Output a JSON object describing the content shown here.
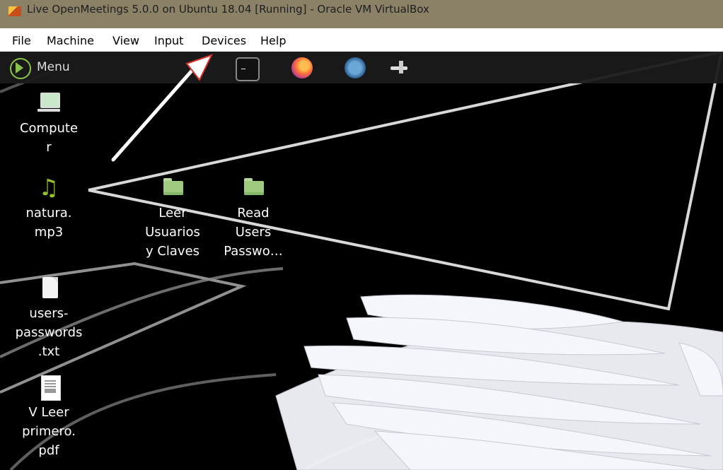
{
  "window": {
    "title": "Live OpenMeetings 5.0.0 on Ubuntu 18.04 [Running] - Oracle VM VirtualBox"
  },
  "menubar": {
    "items": [
      "File",
      "Machine",
      "View",
      "Input",
      "Devices",
      "Help"
    ]
  },
  "panel": {
    "menu_label": "Menu",
    "launchers": [
      "terminal-icon",
      "firefox-icon",
      "network-globe-icon",
      "usb-device-icon"
    ]
  },
  "desktop": {
    "icons": [
      {
        "name": "computer-icon",
        "label": "Compute\nr"
      },
      {
        "name": "music-file-icon",
        "label": "natura.\nmp3"
      },
      {
        "name": "folder-icon",
        "label": "Leer\nUsuarios\ny Claves"
      },
      {
        "name": "folder-icon",
        "label": "Read\nUsers\nPasswo…"
      },
      {
        "name": "text-file-icon",
        "label": "users-\npasswords\n.txt"
      },
      {
        "name": "pdf-file-icon",
        "label": "V Leer\nprimero.\npdf"
      }
    ]
  },
  "annotation": {
    "arrow_color": "#ffffff",
    "accent_color": "#d8342d"
  }
}
